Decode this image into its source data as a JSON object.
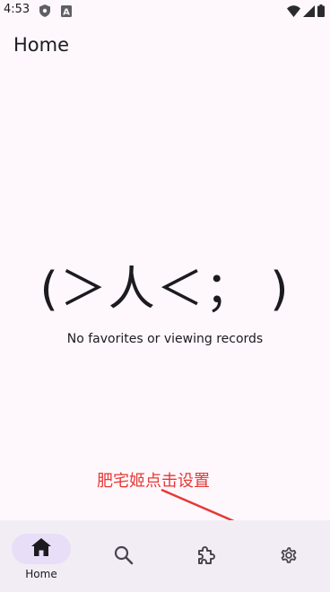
{
  "status_bar": {
    "time": "4:53",
    "icons": [
      "shield-icon",
      "a-icon",
      "wifi-icon",
      "cellular-icon",
      "battery-icon"
    ]
  },
  "app_bar": {
    "title": "Home"
  },
  "empty_state": {
    "kaomoji": "(＞人＜； )",
    "message": "No favorites or viewing records"
  },
  "annotation": {
    "text": "肥宅姬点击设置",
    "color": "#e53935"
  },
  "bottom_nav": {
    "items": [
      {
        "label": "Home",
        "icon": "home-icon",
        "active": true
      },
      {
        "label": "",
        "icon": "search-icon",
        "active": false
      },
      {
        "label": "",
        "icon": "puzzle-icon",
        "active": false
      },
      {
        "label": "",
        "icon": "gear-icon",
        "active": false
      }
    ]
  },
  "colors": {
    "background": "#fef7fc",
    "nav_background": "#f2edf5",
    "active_pill": "#e8def8"
  }
}
